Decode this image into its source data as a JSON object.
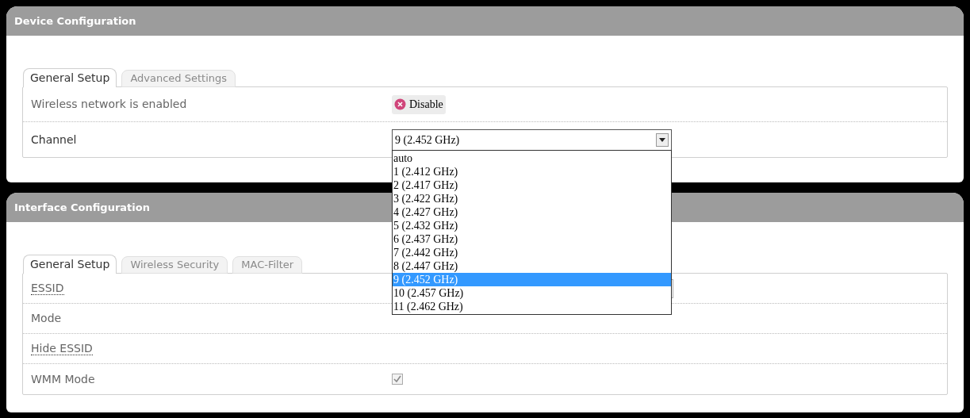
{
  "device_configuration": {
    "title": "Device Configuration",
    "tabs": [
      {
        "label": "General Setup",
        "selected": true
      },
      {
        "label": "Advanced Settings",
        "selected": false
      }
    ],
    "rows": [
      {
        "kind": "button",
        "label": "Wireless network is enabled",
        "button": "Disable"
      },
      {
        "kind": "select",
        "label": "Channel",
        "value": "9 (2.452 GHz)",
        "expanded": true,
        "options": [
          {
            "label": "auto",
            "selected": false
          },
          {
            "label": "1 (2.412 GHz)",
            "selected": false
          },
          {
            "label": "2 (2.417 GHz)",
            "selected": false
          },
          {
            "label": "3 (2.422 GHz)",
            "selected": false
          },
          {
            "label": "4 (2.427 GHz)",
            "selected": false
          },
          {
            "label": "5 (2.432 GHz)",
            "selected": false
          },
          {
            "label": "6 (2.437 GHz)",
            "selected": false
          },
          {
            "label": "7 (2.442 GHz)",
            "selected": false
          },
          {
            "label": "8 (2.447 GHz)",
            "selected": false
          },
          {
            "label": "9 (2.452 GHz)",
            "selected": true
          },
          {
            "label": "10 (2.457 GHz)",
            "selected": false
          },
          {
            "label": "11 (2.462 GHz)",
            "selected": false
          }
        ]
      }
    ]
  },
  "interface_configuration": {
    "title": "Interface Configuration",
    "tabs": [
      {
        "label": "General Setup",
        "selected": true
      },
      {
        "label": "Wireless Security",
        "selected": false
      },
      {
        "label": "MAC-Filter",
        "selected": false
      }
    ],
    "rows": [
      {
        "kind": "text",
        "label": "ESSID",
        "abbr": true
      },
      {
        "kind": "hidden",
        "label": "Mode",
        "abbr": false
      },
      {
        "kind": "hidden",
        "label": "Hide ESSID",
        "abbr": true
      },
      {
        "kind": "checkbox",
        "label": "WMM Mode",
        "abbr": false,
        "checked": true,
        "disabled": true
      }
    ]
  }
}
